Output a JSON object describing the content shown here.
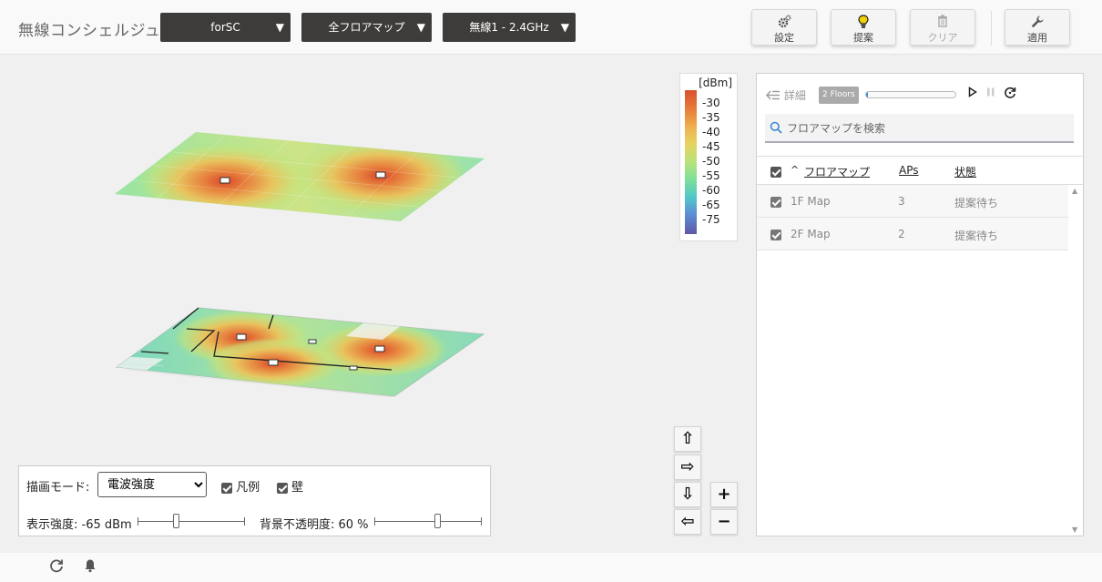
{
  "header": {
    "app_title": "無線コンシェルジュ",
    "dropdowns": [
      {
        "value": "forSC"
      },
      {
        "value": "全フロアマップ"
      },
      {
        "value": "無線1 - 2.4GHz"
      }
    ],
    "dropdown_arrow": "▼",
    "buttons": {
      "settings": "設定",
      "suggest": "提案",
      "clear": "クリア",
      "apply": "適用"
    }
  },
  "legend": {
    "unit": "[dBm]",
    "ticks": [
      "-30",
      "-35",
      "-40",
      "-45",
      "-50",
      "-55",
      "-60",
      "-65",
      "-75"
    ]
  },
  "panel": {
    "back_label": "詳細",
    "floors_badge": "2 Floors",
    "progress": 0.02,
    "search_placeholder": "フロアマップを検索",
    "columns": {
      "sort_indicator": "^",
      "name": "フロアマップ",
      "aps": "APs",
      "status": "状態"
    },
    "rows": [
      {
        "name": "1F Map",
        "aps": "3",
        "status": "提案待ち"
      },
      {
        "name": "2F Map",
        "aps": "2",
        "status": "提案待ち"
      }
    ]
  },
  "controls": {
    "mode_label": "描画モード:",
    "mode_value": "電波強度",
    "legend_checkbox": "凡例",
    "wall_checkbox": "壁",
    "strength_label": "表示強度: -65 dBm",
    "strength_fraction": 0.35,
    "opacity_label": "背景不透明度: 60 %",
    "opacity_fraction": 0.6
  },
  "nav": {
    "up": "⇧",
    "right": "⇨",
    "down": "⇩",
    "left": "⇦",
    "zoom_in": "+",
    "zoom_out": "−"
  },
  "colors": {
    "header_dropdown_bg": "#3e3c3a",
    "accent": "#3c8ad6"
  }
}
